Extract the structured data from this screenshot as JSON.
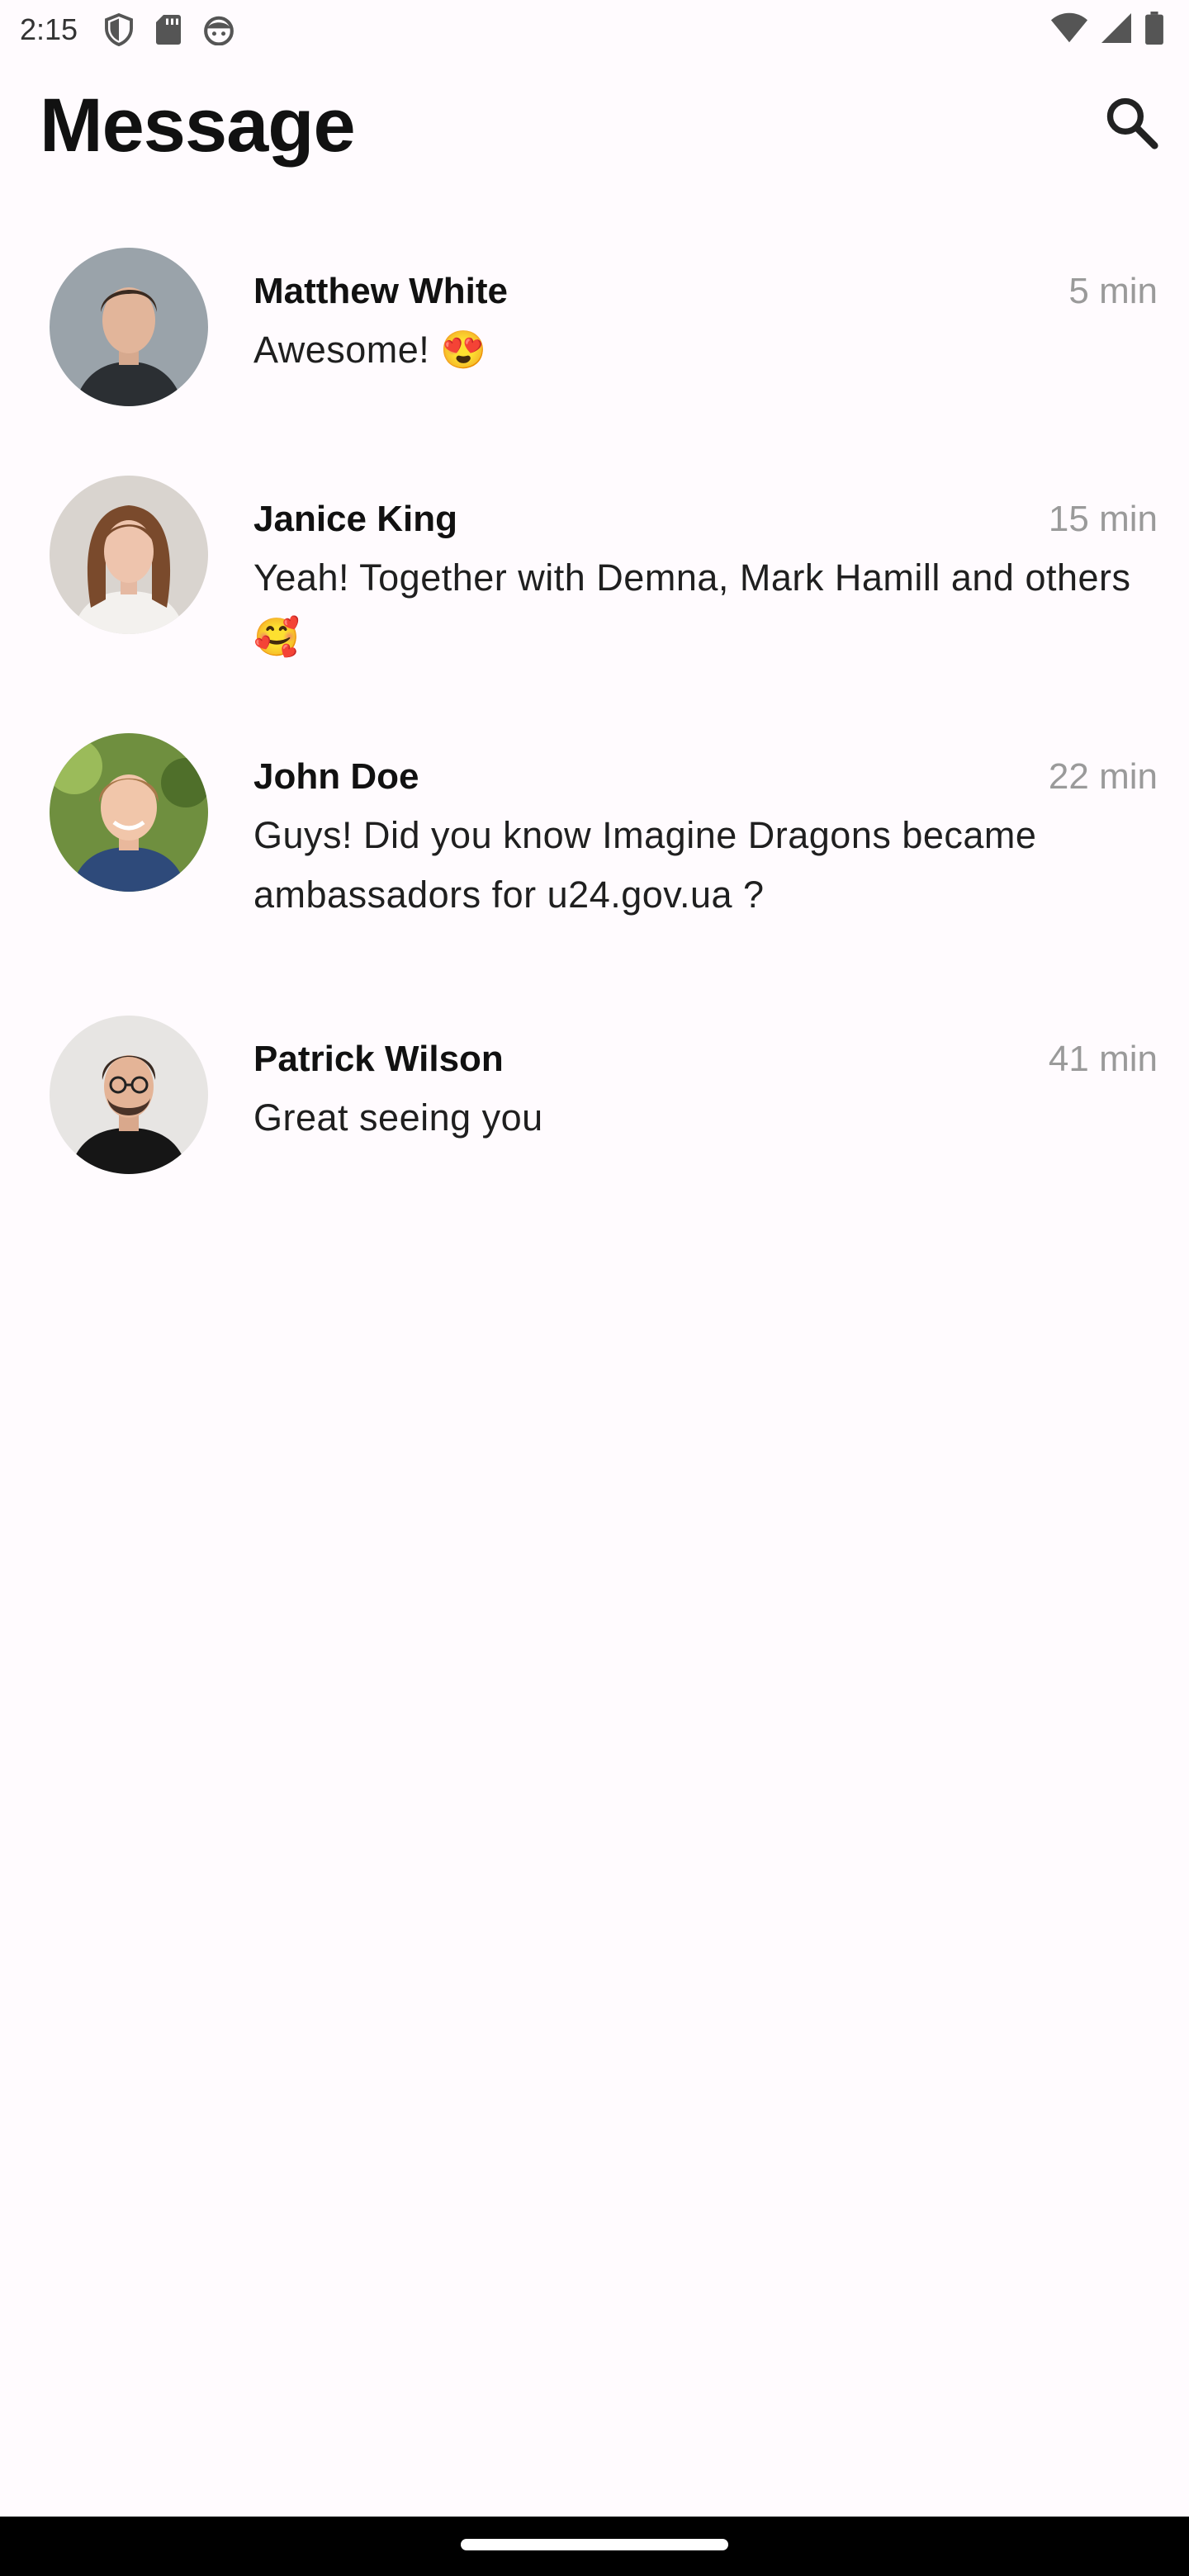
{
  "status_bar": {
    "time": "2:15",
    "left_icons": [
      "shield-icon",
      "sd-card-icon",
      "android-face-icon"
    ],
    "right_icons": [
      "wifi-icon",
      "cellular-signal-icon",
      "battery-icon"
    ]
  },
  "header": {
    "title": "Message",
    "search_icon": "search-icon"
  },
  "messages": [
    {
      "name": "Matthew White",
      "time": "5 min",
      "text": "Awesome! 😍",
      "avatar_bg": "#9aa3aa"
    },
    {
      "name": "Janice King",
      "time": "15 min",
      "text": "Yeah! Together with Demna, Mark Hamill and others 🥰",
      "avatar_bg": "#d9d4cf"
    },
    {
      "name": "John Doe",
      "time": "22 min",
      "text": "Guys! Did you know Imagine Dragons became ambassadors for u24.gov.ua ?",
      "avatar_bg": "#6f8f3f"
    },
    {
      "name": "Patrick Wilson",
      "time": "41 min",
      "text": "Great seeing you",
      "avatar_bg": "#e7e5e3"
    }
  ],
  "colors": {
    "background": "#fffbfe",
    "time_text": "#9a9a9a",
    "nav_bar": "#000000"
  }
}
